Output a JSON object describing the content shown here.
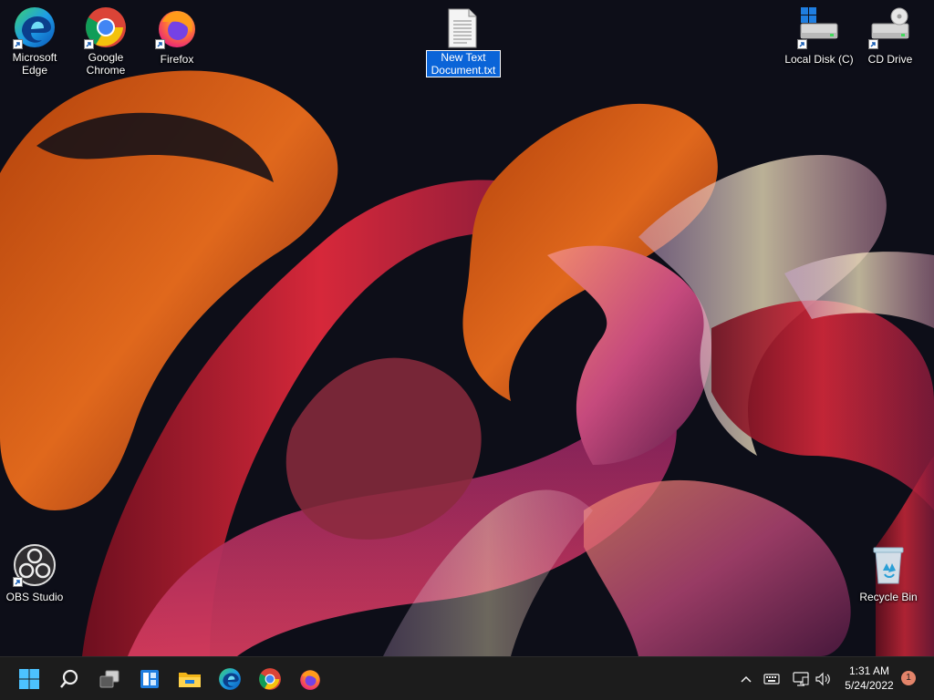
{
  "desktop": {
    "icons": [
      {
        "id": "edge",
        "label": "Microsoft Edge"
      },
      {
        "id": "chrome",
        "label": "Google Chrome"
      },
      {
        "id": "firefox",
        "label": "Firefox"
      },
      {
        "id": "new-text-document",
        "label": "New Text Document.txt",
        "label_line1": "New Text",
        "label_line2": "Document.txt",
        "selected": true
      },
      {
        "id": "local-disk",
        "label": "Local Disk (C)"
      },
      {
        "id": "cd-drive",
        "label": "CD Drive"
      },
      {
        "id": "obs-studio",
        "label": "OBS Studio"
      },
      {
        "id": "recycle-bin",
        "label": "Recycle Bin"
      }
    ]
  },
  "taskbar": {
    "pinned": [
      {
        "name": "start",
        "icon": "windows-logo-icon"
      },
      {
        "name": "search",
        "icon": "search-icon"
      },
      {
        "name": "task-view",
        "icon": "task-view-icon"
      },
      {
        "name": "widgets",
        "icon": "widgets-icon"
      },
      {
        "name": "file-explorer",
        "icon": "folder-icon"
      },
      {
        "name": "edge",
        "icon": "edge-icon"
      },
      {
        "name": "chrome",
        "icon": "chrome-icon"
      },
      {
        "name": "firefox",
        "icon": "firefox-icon"
      }
    ],
    "tray": {
      "time": "1:31 AM",
      "date": "5/24/2022",
      "notifications": "1",
      "icons": [
        "chevron-up-icon",
        "keyboard-icon",
        "network-icon",
        "volume-icon"
      ]
    }
  },
  "colors": {
    "taskbar": "#1c1c1c",
    "selection": "#0a64d8",
    "badge": "#e3846a",
    "wallpaper_base": "#0e0f1a"
  }
}
